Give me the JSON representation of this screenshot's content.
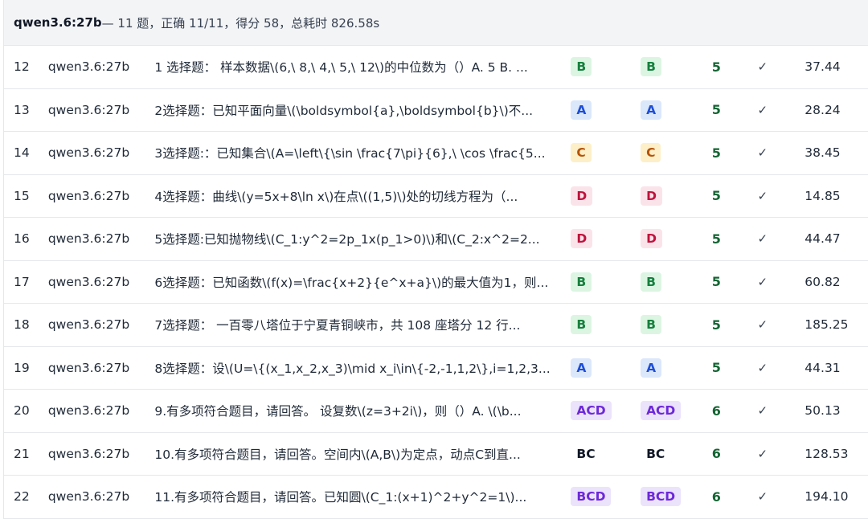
{
  "header": {
    "model": "qwen3.6:27b",
    "summary": " — 11 题，正确 11/11，得分 58，总耗时 826.58s"
  },
  "rows": [
    {
      "index": "12",
      "model": "qwen3.6:27b",
      "question": "1 选择题： 样本数据\\(6,\\ 8,\\ 4,\\ 5,\\ 12\\)的中位数为（）A. 5 B. ...",
      "answer": "B",
      "expected": "B",
      "score": "5",
      "correct": "✓",
      "time": "37.44"
    },
    {
      "index": "13",
      "model": "qwen3.6:27b",
      "question": "2选择题：已知平面向量\\(\\boldsymbol{a},\\boldsymbol{b}\\)不...",
      "answer": "A",
      "expected": "A",
      "score": "5",
      "correct": "✓",
      "time": "28.24"
    },
    {
      "index": "14",
      "model": "qwen3.6:27b",
      "question": "3选择题:：已知集合\\(A=\\left\\{\\sin \\frac{7\\pi}{6},\\ \\cos \\frac{5...",
      "answer": "C",
      "expected": "C",
      "score": "5",
      "correct": "✓",
      "time": "38.45"
    },
    {
      "index": "15",
      "model": "qwen3.6:27b",
      "question": "4选择题：曲线\\(y=5x+8\\ln x\\)在点\\((1,5)\\)处的切线方程为（...",
      "answer": "D",
      "expected": "D",
      "score": "5",
      "correct": "✓",
      "time": "14.85"
    },
    {
      "index": "16",
      "model": "qwen3.6:27b",
      "question": "5选择题:已知抛物线\\(C_1:y^2=2p_1x(p_1>0)\\)和\\(C_2:x^2=2...",
      "answer": "D",
      "expected": "D",
      "score": "5",
      "correct": "✓",
      "time": "44.47"
    },
    {
      "index": "17",
      "model": "qwen3.6:27b",
      "question": "6选择题：已知函数\\(f(x)=\\frac{x+2}{e^x+a}\\)的最大值为1，则...",
      "answer": "B",
      "expected": "B",
      "score": "5",
      "correct": "✓",
      "time": "60.82"
    },
    {
      "index": "18",
      "model": "qwen3.6:27b",
      "question": "7选择题： 一百零八塔位于宁夏青铜峡市，共 108 座塔分 12 行...",
      "answer": "B",
      "expected": "B",
      "score": "5",
      "correct": "✓",
      "time": "185.25"
    },
    {
      "index": "19",
      "model": "qwen3.6:27b",
      "question": "8选择题：设\\(U=\\{(x_1,x_2,x_3)\\mid x_i\\in\\{-2,-1,1,2\\},i=1,2,3...",
      "answer": "A",
      "expected": "A",
      "score": "5",
      "correct": "✓",
      "time": "44.31"
    },
    {
      "index": "20",
      "model": "qwen3.6:27b",
      "question": "9.有多项符合题目，请回答。 设复数\\(z=3+2i\\)，则（）A. \\(\\b...",
      "answer": "ACD",
      "expected": "ACD",
      "score": "6",
      "correct": "✓",
      "time": "50.13"
    },
    {
      "index": "21",
      "model": "qwen3.6:27b",
      "question": "10.有多项符合题目，请回答。空间内\\(A,B\\)为定点，动点C到直...",
      "answer": "BC",
      "expected": "BC",
      "score": "6",
      "correct": "✓",
      "time": "128.53"
    },
    {
      "index": "22",
      "model": "qwen3.6:27b",
      "question": "11.有多项符合题目，请回答。已知圆\\(C_1:(x+1)^2+y^2=1\\)...",
      "answer": "BCD",
      "expected": "BCD",
      "score": "6",
      "correct": "✓",
      "time": "194.10"
    }
  ]
}
